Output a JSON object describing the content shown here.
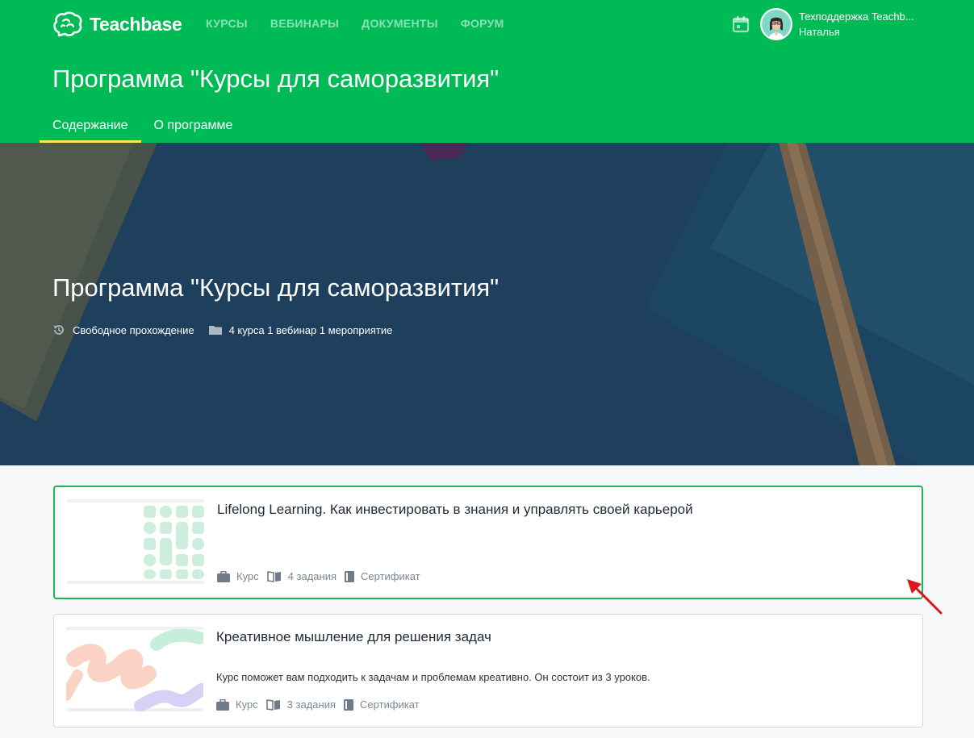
{
  "header": {
    "brand": "Teachbase",
    "nav": [
      "КУРСЫ",
      "ВЕБИНАРЫ",
      "ДОКУМЕНТЫ",
      "ФОРУМ"
    ],
    "user": {
      "name": "Техподдержка Teachb...",
      "subname": "Наталья"
    },
    "title": "Программа \"Курсы для саморазвития\"",
    "tabs": [
      "Содержание",
      "О программе"
    ]
  },
  "hero": {
    "title": "Программа \"Курсы для саморазвития\"",
    "meta": [
      "Свободное прохождение",
      "4 курса 1 вебинар 1 мероприятие"
    ]
  },
  "cards": [
    {
      "title": "Lifelong Learning. Как инвестировать в знания и управлять своей карьерой",
      "description": "",
      "type": "Курс",
      "tasks": "4 задания",
      "certificate": "Сертификат"
    },
    {
      "title": "Креативное мышление для решения задач",
      "description": "Курс поможет вам подходить к задачам и проблемам креативно. Он состоит из 3 уроков.",
      "type": "Курс",
      "tasks": "3 задания",
      "certificate": "Сертификат"
    }
  ],
  "colors": {
    "brand_green": "#00bb55",
    "tab_underline": "#ffe94a",
    "hero_bg": "#234766",
    "annotation_arrow": "#e0141e"
  },
  "icons": [
    "brain-logo-icon",
    "calendar-icon",
    "history-icon",
    "folder-icon",
    "briefcase-icon",
    "book-open-icon",
    "certificate-icon",
    "red-arrow-annotation"
  ]
}
